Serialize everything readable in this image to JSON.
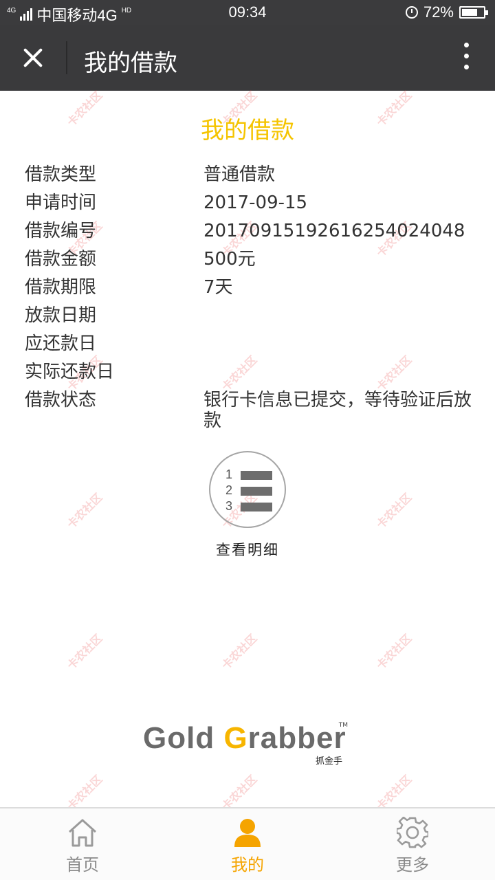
{
  "status_bar": {
    "network_small": "4G",
    "carrier": "中国移动4G",
    "hd": "HD",
    "time": "09:34",
    "battery": "72%",
    "battery_level": 0.72
  },
  "title_bar": {
    "title": "我的借款",
    "close_icon": "close-icon",
    "more_icon": "more-vertical-icon"
  },
  "loan": {
    "heading": "我的借款",
    "heading_color": "#f5c400",
    "rows": [
      {
        "label": "借款类型",
        "value": "普通借款"
      },
      {
        "label": "申请时间",
        "value": "2017-09-15"
      },
      {
        "label": "借款编号",
        "value": "20170915192616254024048"
      },
      {
        "label": "借款金额",
        "value": "500元"
      },
      {
        "label": "借款期限",
        "value": "7天"
      },
      {
        "label": "放款日期",
        "value": ""
      },
      {
        "label": "应还款日",
        "value": ""
      },
      {
        "label": "实际还款日",
        "value": ""
      },
      {
        "label": "借款状态",
        "value": "银行卡信息已提交，等待验证后放款"
      }
    ]
  },
  "details_button": {
    "label": "查看明细",
    "icon": "numbered-list-icon",
    "numbers": [
      "1",
      "2",
      "3"
    ]
  },
  "logo": {
    "word1": "Gold",
    "word2_first": "G",
    "word2_rest": "rabber",
    "tm": "TM",
    "subtitle": "抓金手"
  },
  "watermark": "卡农社区",
  "bottom_nav": {
    "active_color": "#f5a400",
    "inactive_color": "#8a8a8a",
    "items": [
      {
        "label": "首页",
        "icon": "home-icon",
        "active": false
      },
      {
        "label": "我的",
        "icon": "user-icon",
        "active": true
      },
      {
        "label": "更多",
        "icon": "gear-icon",
        "active": false
      }
    ]
  }
}
